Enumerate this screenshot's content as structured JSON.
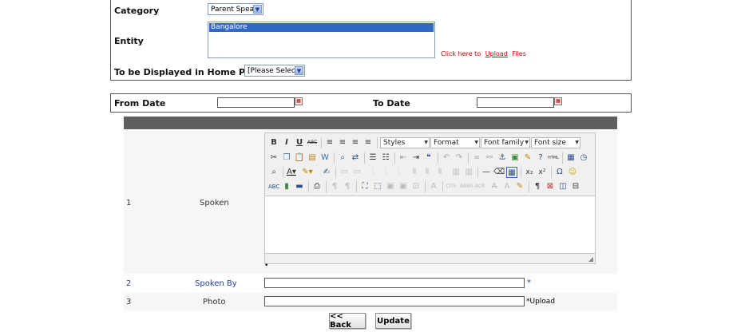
{
  "form": {
    "category_label": "Category",
    "category_value": "Parent Speak",
    "entity_label": "Entity",
    "entity_selected": "Bangalore",
    "upload_prefix": "Click here to",
    "upload_link": "Upload",
    "upload_suffix": "Files",
    "home_label": "To be Displayed in Home Page",
    "home_value": "[Please Select]"
  },
  "dates": {
    "from_label": "From Date",
    "to_label": "To Date"
  },
  "table": {
    "rows": [
      {
        "num": "1",
        "label": "Spoken"
      },
      {
        "num": "2",
        "label": "Spoken By",
        "required": "*"
      },
      {
        "num": "3",
        "label": "Photo",
        "required": "*",
        "extra": "Upload"
      }
    ],
    "editor_bullet": "•"
  },
  "editor": {
    "toolbar": {
      "bold": "B",
      "italic": "I",
      "underline": "U",
      "strike": "ABC",
      "styles": "Styles",
      "format": "Format",
      "font_family": "Font family",
      "font_size": "Font size"
    }
  },
  "buttons": {
    "back": "<< Back",
    "update": "Update"
  },
  "colors": {
    "header_bar": "#5f5f5f",
    "link_blue": "#1a3f9a",
    "upload_red": "#cc0000",
    "row_bg": "#f6f6f6"
  }
}
